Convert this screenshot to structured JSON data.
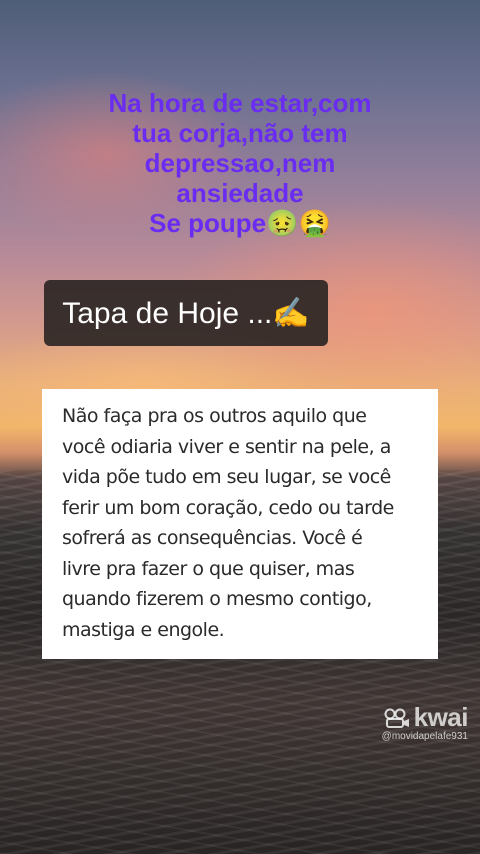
{
  "headline": {
    "lines": [
      "Na hora de estar,com",
      "tua corja,não tem",
      "depressao,nem",
      "ansiedade",
      "Se poupe🤢🤮"
    ]
  },
  "badge": {
    "text": "Tapa de Hoje ...✍️"
  },
  "card": {
    "lines": [
      "Não faça pra os outros aquilo que",
      "você odiaria viver e sentir na pele, a",
      "vida põe tudo em seu lugar, se você",
      "ferir um bom coração, cedo ou tarde",
      "sofrerá as consequências. Você é",
      "livre pra fazer o que quiser, mas",
      "quando fizerem o mesmo contigo,",
      "mastiga e engole."
    ]
  },
  "watermark": {
    "brand": "kwai",
    "handle": "@movidapelafe931",
    "icon": "kwai-logo-icon"
  },
  "colors": {
    "headline": "#6a2cf0",
    "badge_bg": "#2c2624",
    "card_bg": "#ffffff"
  }
}
